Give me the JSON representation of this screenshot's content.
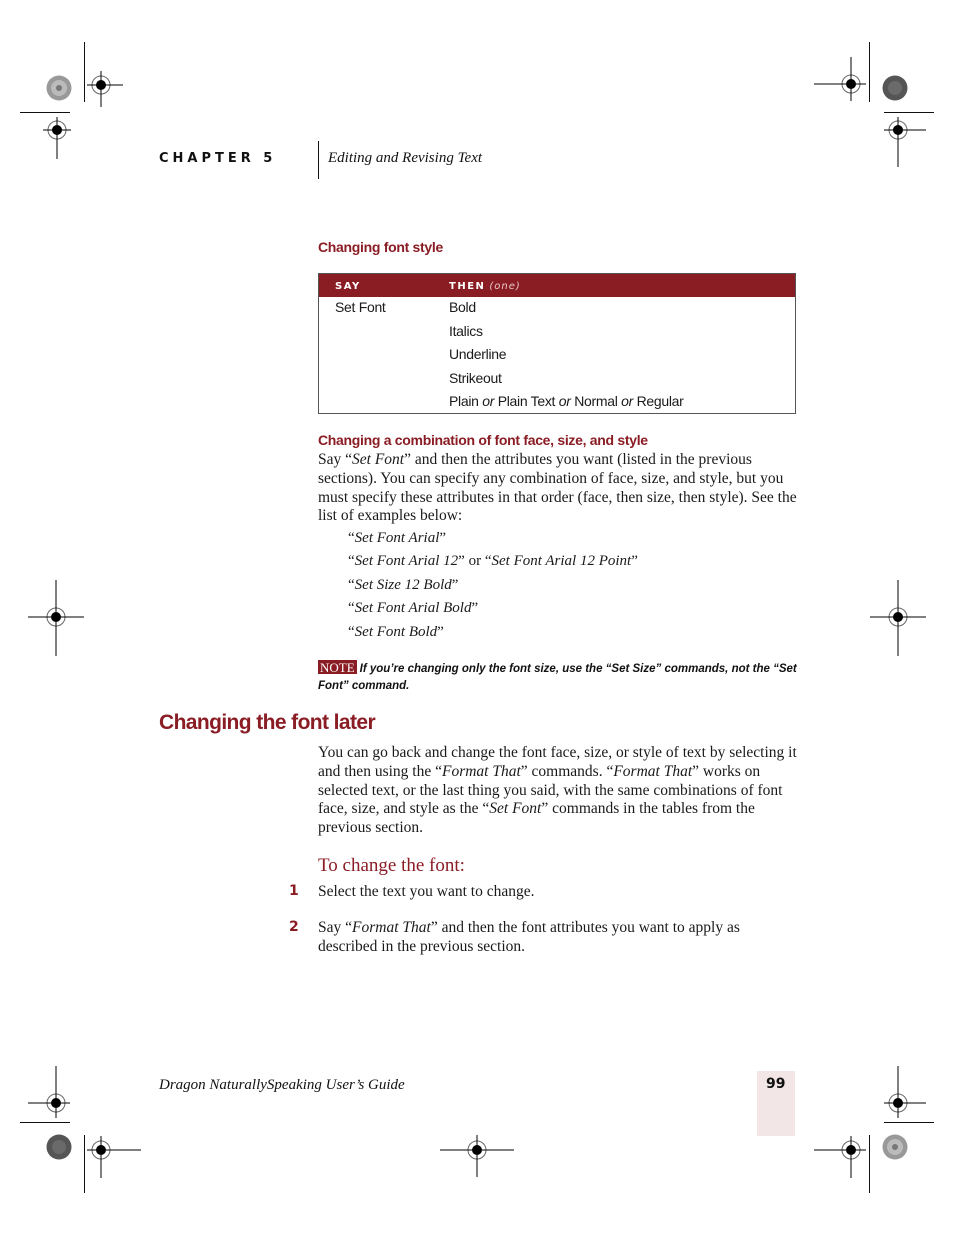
{
  "header": {
    "chapter_label": "CHAPTER 5",
    "section_title": "Editing and Revising Text"
  },
  "section_font_style": {
    "heading": "Changing font style",
    "table": {
      "col_say": "SAY",
      "col_then": "THEN",
      "col_then_note": "(one)",
      "say_value": "Set Font",
      "then_values": [
        "Bold",
        "Italics",
        "Underline",
        "Strikeout"
      ],
      "last_row": {
        "a": "Plain",
        "or1": "or",
        "b": "Plain Text",
        "or2": "or",
        "c": "Normal",
        "or3": "or",
        "d": "Regular"
      }
    }
  },
  "section_combination": {
    "heading": "Changing a combination of font face, size, and style",
    "para_say": "Say “",
    "para_cmd": "Set Font",
    "para_rest": "” and then the attributes you want (listed in the previous sections). You can specify any combination of face, size, and style, but you must specify these attributes in that order (face, then size, then style). See the list of examples below:",
    "examples": [
      "Set Font Arial",
      "Set Font Arial 12",
      "Set Size 12 Bold",
      "Set Font Arial Bold",
      "Set Font Bold"
    ],
    "example_alt_joiner": "or",
    "example_alt": "Set Font Arial 12 Point",
    "open_quote": "“",
    "close_quote": "”"
  },
  "note": {
    "badge": "NOTE",
    "text": "If you’re changing only the font size, use the “Set Size” commands, not the “Set Font” command."
  },
  "section_later": {
    "heading": "Changing the font later",
    "p_a": "You can go back and change the font face, size, or style of text by selecting it and then using the “",
    "p_cmd1": "Format That",
    "p_b": "” commands. “",
    "p_cmd2": "Format That",
    "p_c": "” works on selected text, or the last thing you said, with the same combinations of font face, size, and style as the “",
    "p_cmd3": "Set Font",
    "p_d": "” commands in the tables from the previous section."
  },
  "procedure": {
    "title": "To change the font:",
    "steps": [
      {
        "number": "1",
        "text": "Select the text you want to change."
      },
      {
        "number": "2",
        "text_a": "Say “",
        "cmd": "Format That",
        "text_b": "” and then the font attributes you want to apply as described in the previous section."
      }
    ]
  },
  "footer": {
    "book_title": "Dragon NaturallySpeaking User’s Guide",
    "page_number": "99"
  },
  "colors": {
    "accent": "#8a1c24",
    "page_tab": "#f2e6e7"
  }
}
